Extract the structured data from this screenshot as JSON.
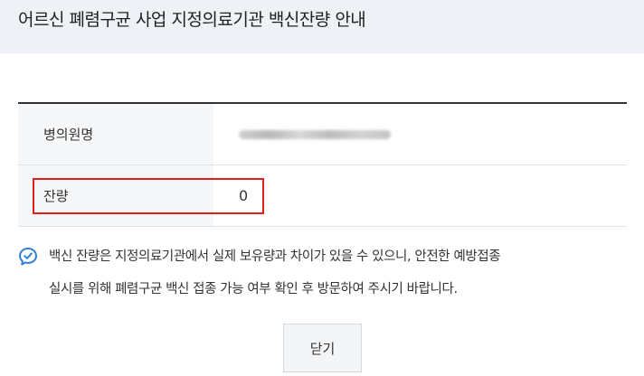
{
  "header": {
    "title": "어르신 폐렴구균 사업 지정의료기관 백신잔량 안내"
  },
  "table": {
    "rows": [
      {
        "label": "병의원명",
        "value": ""
      },
      {
        "label": "잔량",
        "value": "0"
      }
    ]
  },
  "notice": {
    "icon": "chat-check-icon",
    "line1": "백신 잔량은 지정의료기관에서 실제 보유량과 차이가 있을 수 있으니, 안전한 예방접종",
    "line2": "실시를 위해 폐렴구균 백신 접종 가능 여부 확인 후 방문하여 주시기 바랍니다."
  },
  "buttons": {
    "close_label": "닫기"
  },
  "colors": {
    "header_bg": "#eef1f6",
    "label_bg": "#f6f7f9",
    "accent_blue": "#2f7fd8",
    "highlight_red": "#e02020"
  }
}
